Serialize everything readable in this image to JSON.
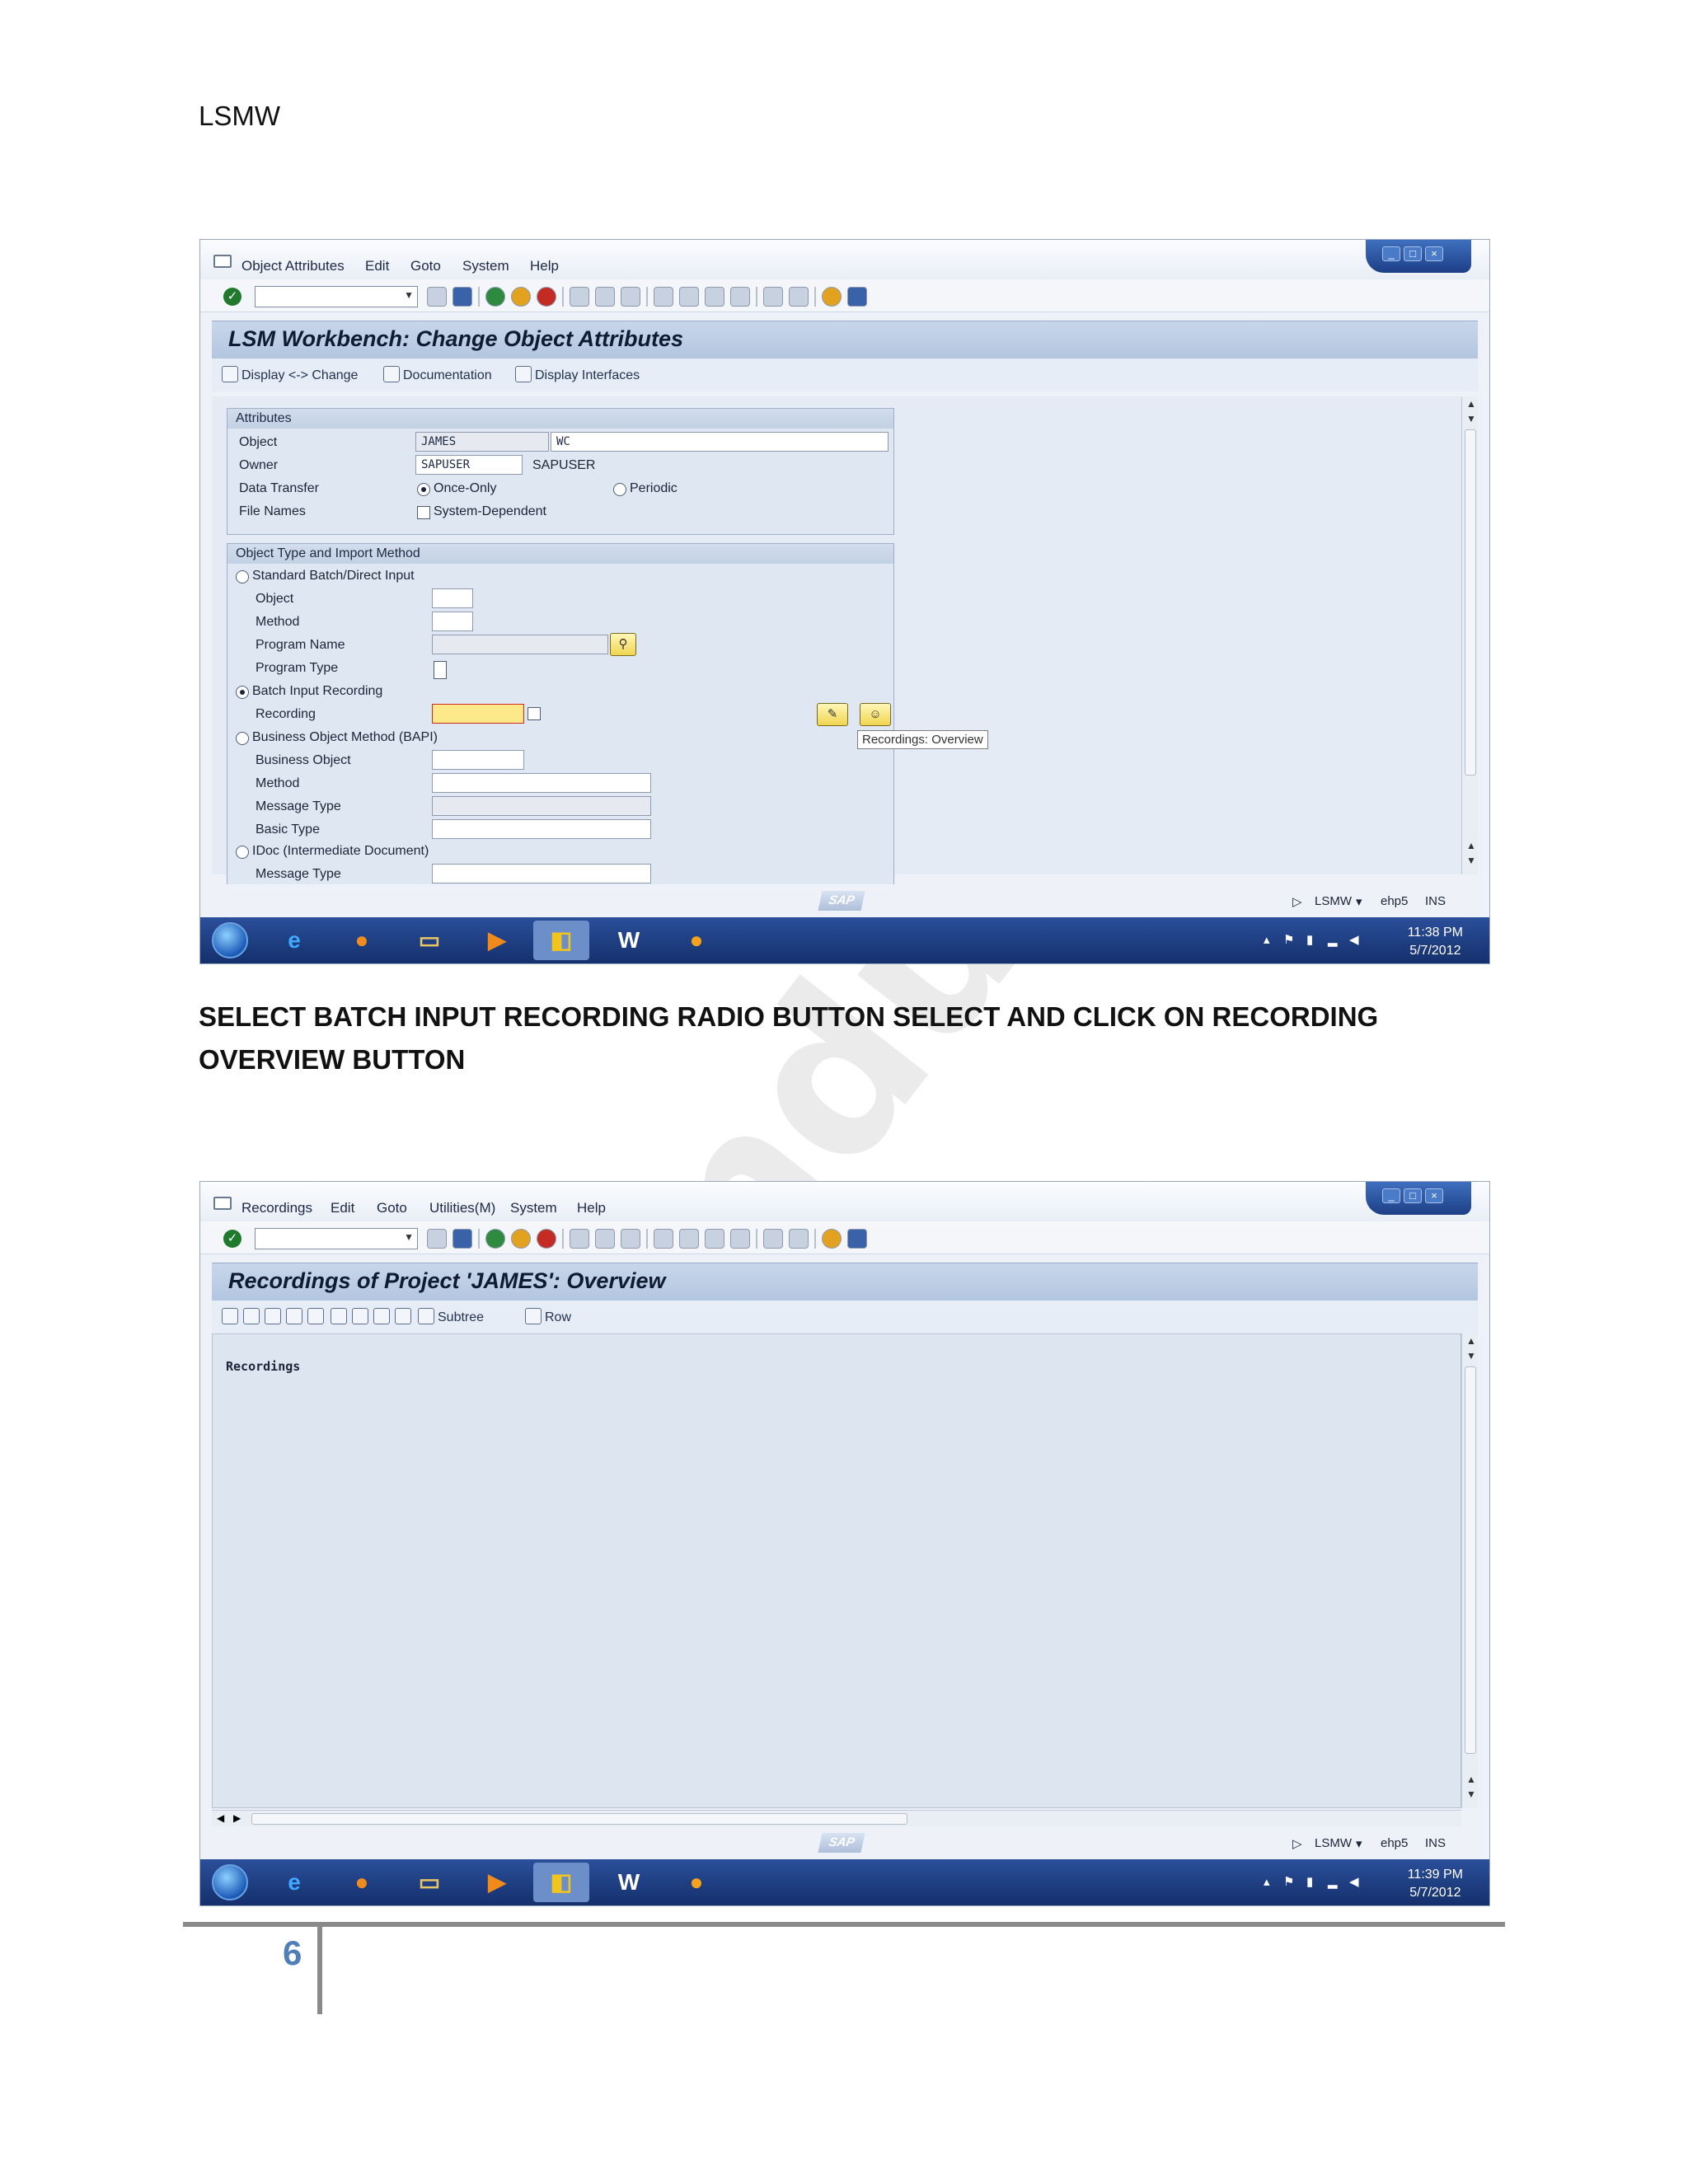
{
  "page": {
    "header": "LSMW",
    "instruction": "SELECT BATCH INPUT RECORDING RADIO BUTTON SELECT AND CLICK ON RECORDING OVERVIEW BUTTON",
    "page_number": "6",
    "watermark": "ndu"
  },
  "screen1": {
    "menu": [
      "Object Attributes",
      "Edit",
      "Goto",
      "System",
      "Help"
    ],
    "title": "LSM Workbench: Change Object Attributes",
    "app_toolbar": {
      "display_change": "Display <-> Change",
      "documentation": "Documentation",
      "display_interfaces": "Display Interfaces"
    },
    "attributes": {
      "header": "Attributes",
      "object_label": "Object",
      "object_value": "JAMES",
      "object_desc": "WC",
      "owner_label": "Owner",
      "owner_value": "SAPUSER",
      "owner_desc": "SAPUSER",
      "data_transfer_label": "Data Transfer",
      "once_only": "Once-Only",
      "periodic": "Periodic",
      "file_names_label": "File Names",
      "system_dependent": "System-Dependent"
    },
    "import_method": {
      "header": "Object Type and Import Method",
      "standard_batch": "Standard Batch/Direct Input",
      "object": "Object",
      "method": "Method",
      "program_name": "Program Name",
      "program_type": "Program Type",
      "batch_input_recording": "Batch Input Recording",
      "recording": "Recording",
      "bapi": "Business Object Method  (BAPI)",
      "business_object": "Business Object",
      "method2": "Method",
      "message_type": "Message Type",
      "basic_type": "Basic Type",
      "idoc": "IDoc (Intermediate Document)",
      "message_type2": "Message Type"
    },
    "tooltip": "Recordings: Overview",
    "status": {
      "system": "LSMW",
      "server": "ehp5",
      "mode": "INS"
    },
    "clock": {
      "time": "11:38 PM",
      "date": "5/7/2012"
    }
  },
  "screen2": {
    "menu": [
      "Recordings",
      "Edit",
      "Goto",
      "Utilities(M)",
      "System",
      "Help"
    ],
    "title": "Recordings of Project 'JAMES': Overview",
    "app_toolbar": {
      "subtree": "Subtree",
      "row": "Row"
    },
    "tree_root": "Recordings",
    "status": {
      "system": "LSMW",
      "server": "ehp5",
      "mode": "INS"
    },
    "clock": {
      "time": "11:39 PM",
      "date": "5/7/2012"
    }
  },
  "sap_logo": "SAP",
  "colors": {
    "sap_title": "#b3c6e0",
    "taskbar": "#14306c",
    "page_number": "#4f7fb8"
  }
}
